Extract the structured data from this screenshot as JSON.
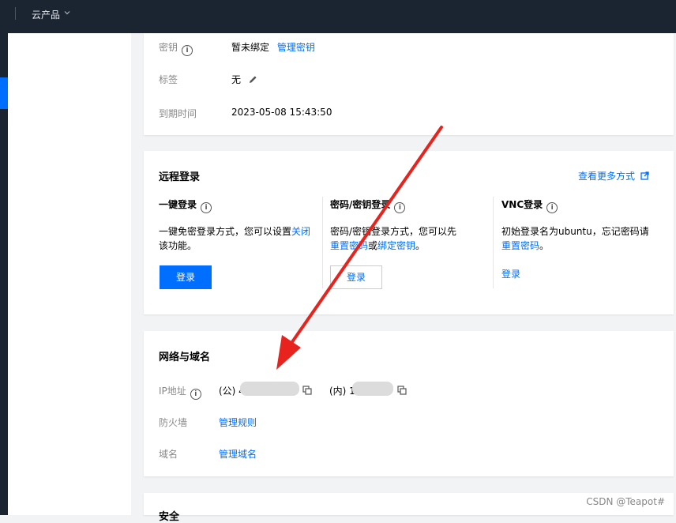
{
  "topbar": {
    "product_menu": "云产品"
  },
  "info_card": {
    "key_label": "密钥",
    "key_value": "暂未绑定",
    "key_link": "管理密钥",
    "tag_label": "标签",
    "tag_value": "无",
    "expire_label": "到期时间",
    "expire_value": "2023-05-08 15:43:50"
  },
  "remote": {
    "title": "远程登录",
    "more_link": "查看更多方式",
    "one_click": {
      "title": "一键登录",
      "desc_prefix": "一键免密登录方式，您可以设置",
      "desc_link": "关闭",
      "desc_suffix": "该功能。",
      "button": "登录"
    },
    "password": {
      "title": "密码/密钥登录",
      "desc_line1": "密码/密钥登录方式，您可以先",
      "link1": "重置密码",
      "or": "或",
      "link2": "绑定密钥",
      "end": "。",
      "button": "登录"
    },
    "vnc": {
      "title": "VNC登录",
      "desc_line1": "初始登录名为ubuntu，忘记密码请",
      "link": "重置密码",
      "end": "。",
      "login_link": "登录"
    }
  },
  "network": {
    "title": "网络与域名",
    "ip_label": "IP地址",
    "public_prefix": "(公) 4",
    "private_prefix": "(内) 1",
    "firewall_label": "防火墙",
    "firewall_link": "管理规则",
    "domain_label": "域名",
    "domain_link": "管理域名"
  },
  "security": {
    "title": "安全"
  },
  "watermark": "CSDN @Teapot#",
  "colors": {
    "accent": "#006eff",
    "topbar": "#1b2431",
    "arrow": "#e8231d"
  }
}
